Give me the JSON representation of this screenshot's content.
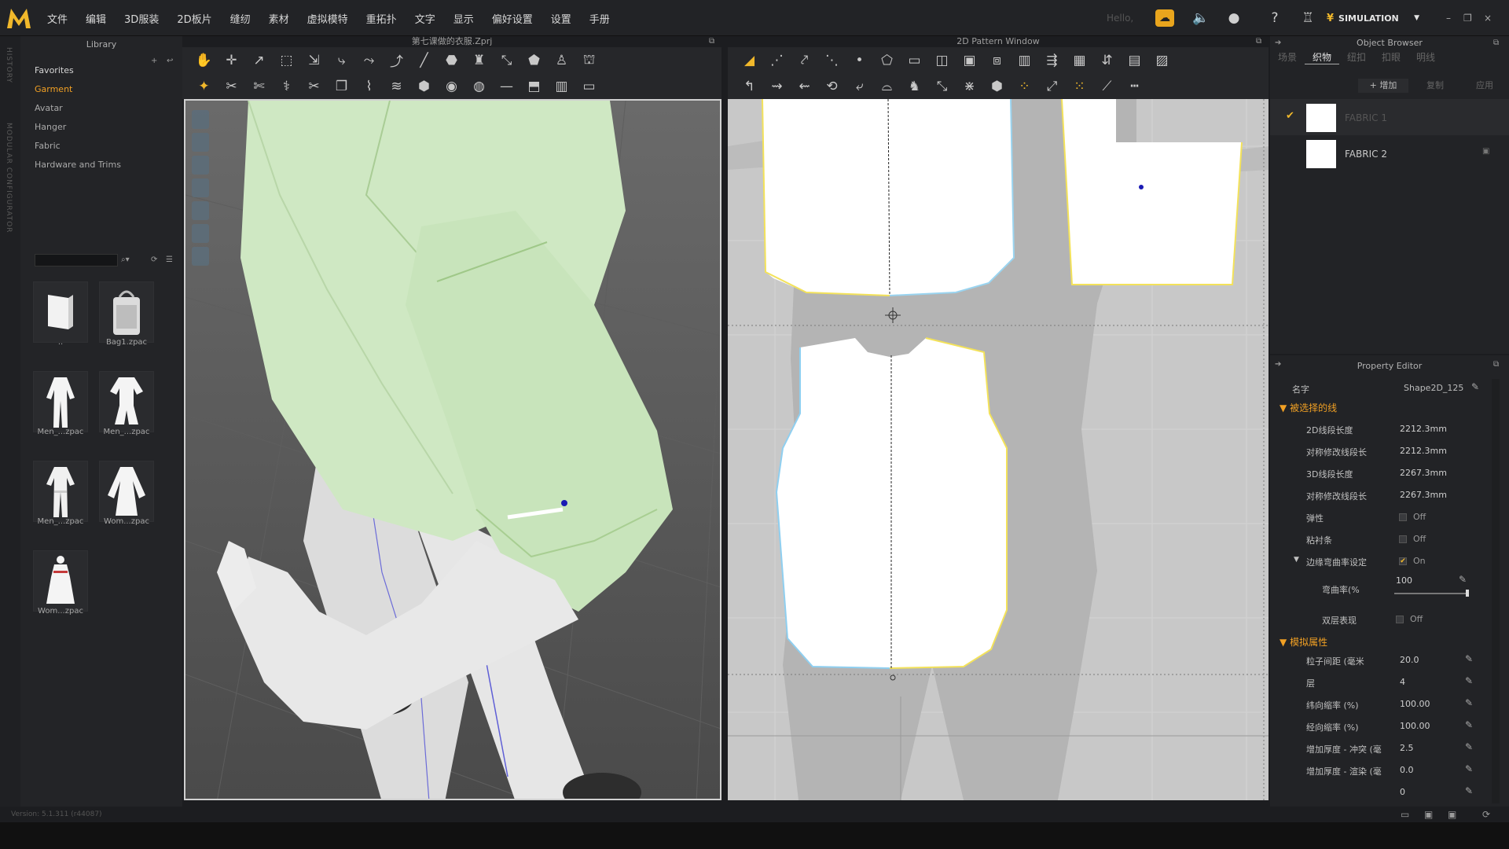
{
  "menubar": {
    "logo": "M",
    "items": [
      "文件",
      "编辑",
      "3D服装",
      "2D板片",
      "缝纫",
      "素材",
      "虚拟模特",
      "重拓扑",
      "文字",
      "显示",
      "偏好设置",
      "设置",
      "手册"
    ],
    "hello": "Hello,",
    "simulation": "SIMULATION",
    "icons": [
      "cloud-icon",
      "speaker-icon",
      "user-icon",
      "help-icon",
      "hanger-icon"
    ]
  },
  "side_strip": {
    "history": "HISTORY",
    "modular": "MODULAR CONFIGURATOR"
  },
  "library": {
    "title": "Library",
    "favorites": "Favorites",
    "items": [
      "Garment",
      "Avatar",
      "Hanger",
      "Fabric",
      "Hardware and Trims"
    ],
    "selected": "Garment",
    "thumbs": [
      {
        "label": "..",
        "icon": "folder-icon"
      },
      {
        "label": "Bag1.zpac",
        "icon": "bag-icon"
      },
      {
        "label": "Men_...zpac",
        "icon": "suit-icon"
      },
      {
        "label": "Men_...zpac",
        "icon": "shirt-shorts-icon"
      },
      {
        "label": "Men_...zpac",
        "icon": "shirt-pants-icon"
      },
      {
        "label": "Wom...zpac",
        "icon": "dress-icon"
      },
      {
        "label": "Wom...zpac",
        "icon": "red-dress-icon"
      }
    ]
  },
  "window3d": {
    "title": "第七课做的衣服.Zprj"
  },
  "window2d": {
    "title": "2D Pattern Window"
  },
  "object_browser": {
    "title": "Object Browser",
    "tabs": [
      "场景",
      "织物",
      "纽扣",
      "扣眼",
      "明线"
    ],
    "active_tab": "织物",
    "buttons": {
      "add": "+ 增加",
      "copy": "复制",
      "apply": "应用"
    },
    "fabrics": [
      "FABRIC 1",
      "FABRIC 2"
    ]
  },
  "property_editor": {
    "title": "Property Editor",
    "name_label": "名字",
    "name_value": "Shape2D_125",
    "section_selected_line": "被选择的线",
    "rows1": [
      {
        "k": "2D线段长度",
        "v": "2212.3mm"
      },
      {
        "k": "对称修改线段长",
        "v": "2212.3mm"
      },
      {
        "k": "3D线段长度",
        "v": "2267.3mm"
      },
      {
        "k": "对称修改线段长",
        "v": "2267.3mm"
      }
    ],
    "elastic": {
      "k": "弹性",
      "v": "Off"
    },
    "fusible": {
      "k": "粘衬条",
      "v": "Off"
    },
    "curvature_setting": {
      "k": "边缘弯曲率设定",
      "v": "On"
    },
    "curvature": {
      "k": "弯曲率(%",
      "v": "100"
    },
    "double_layer": {
      "k": "双层表现",
      "v": "Off"
    },
    "section_sim": "模拟属性",
    "rows2": [
      {
        "k": "粒子间距 (毫米",
        "v": "20.0"
      },
      {
        "k": "层",
        "v": "4"
      },
      {
        "k": "纬向缩率 (%)",
        "v": "100.00"
      },
      {
        "k": "经向缩率 (%)",
        "v": "100.00"
      },
      {
        "k": "增加厚度 - 冲突 (毫",
        "v": "2.5"
      },
      {
        "k": "增加厚度 - 渲染 (毫",
        "v": "0.0"
      },
      {
        "k": "",
        "v": "0"
      }
    ]
  },
  "status": {
    "version": "Version: 5.1.311 (r44087)"
  },
  "colors": {
    "accent": "#f1a024",
    "garment": "#cfe8c3",
    "selection": "#f3e25a"
  }
}
